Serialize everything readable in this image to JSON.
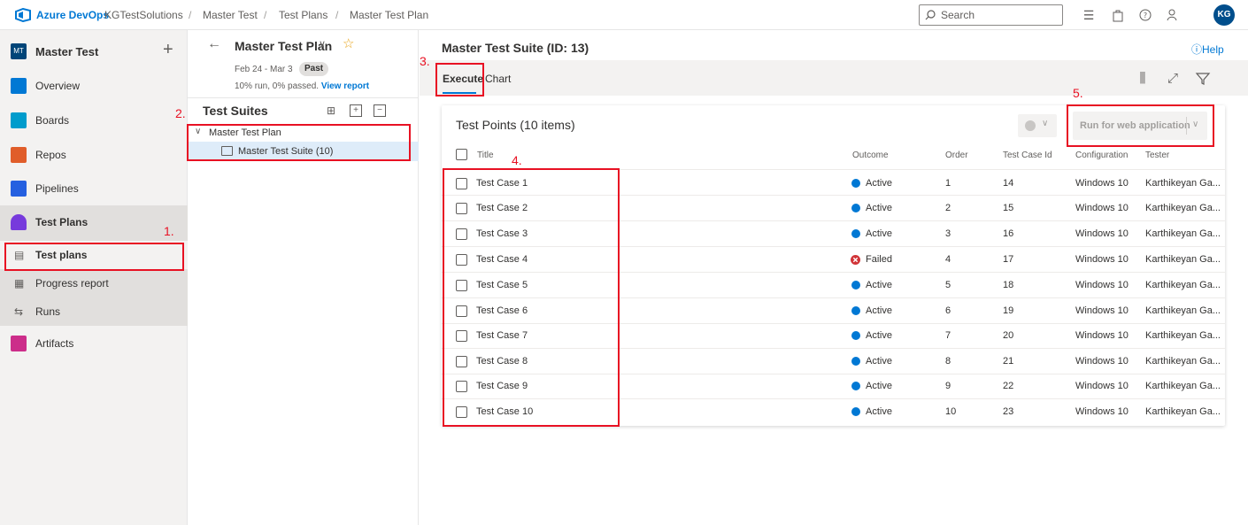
{
  "topbar": {
    "brand": "Azure DevOps",
    "org": "KGTestSolutions",
    "breadcrumbs": [
      "Master Test",
      "Test Plans",
      "Master Test Plan"
    ],
    "separator": "/",
    "search_placeholder": "Search",
    "avatar_initials": "KG"
  },
  "project": {
    "badge": "MT",
    "name": "Master Test",
    "add": "+"
  },
  "nav": {
    "items": [
      {
        "label": "Overview",
        "color": "#0078d4"
      },
      {
        "label": "Boards",
        "color": "#009ccc"
      },
      {
        "label": "Repos",
        "color": "#e05d2a"
      },
      {
        "label": "Pipelines",
        "color": "#2560e0"
      },
      {
        "label": "Test Plans",
        "color": "#773adc"
      },
      {
        "label": "Artifacts",
        "color": "#cc2d8a"
      }
    ],
    "sub_items": [
      {
        "label": "Test plans",
        "icon": "test-plans-icon"
      },
      {
        "label": "Progress report",
        "icon": "progress-report-icon"
      },
      {
        "label": "Runs",
        "icon": "runs-icon"
      }
    ]
  },
  "plan": {
    "title": "Master Test Plan",
    "dates": "Feb 24 - Mar 3",
    "state": "Past",
    "stats": "10% run, 0% passed.",
    "stats_link": "View report"
  },
  "suites": {
    "title": "Test Suites",
    "root": "Master Test Plan",
    "child": "Master Test Suite (10)"
  },
  "annotations": [
    "1.",
    "2.",
    "3.",
    "4.",
    "5."
  ],
  "main": {
    "suite_title": "Master Test Suite (ID: 13)",
    "help": "Help",
    "tabs": [
      "Execute",
      "Chart"
    ],
    "points_title": "Test Points (10 items)",
    "run_button": "Run for web application",
    "columns": [
      "Title",
      "Outcome",
      "Order",
      "Test Case Id",
      "Configuration",
      "Tester"
    ],
    "rows": [
      {
        "title": "Test Case 1",
        "outcome": "Active",
        "order": "1",
        "id": "14",
        "config": "Windows 10",
        "tester": "Karthikeyan Ga..."
      },
      {
        "title": "Test Case 2",
        "outcome": "Active",
        "order": "2",
        "id": "15",
        "config": "Windows 10",
        "tester": "Karthikeyan Ga..."
      },
      {
        "title": "Test Case 3",
        "outcome": "Active",
        "order": "3",
        "id": "16",
        "config": "Windows 10",
        "tester": "Karthikeyan Ga..."
      },
      {
        "title": "Test Case 4",
        "outcome": "Failed",
        "order": "4",
        "id": "17",
        "config": "Windows 10",
        "tester": "Karthikeyan Ga..."
      },
      {
        "title": "Test Case 5",
        "outcome": "Active",
        "order": "5",
        "id": "18",
        "config": "Windows 10",
        "tester": "Karthikeyan Ga..."
      },
      {
        "title": "Test Case 6",
        "outcome": "Active",
        "order": "6",
        "id": "19",
        "config": "Windows 10",
        "tester": "Karthikeyan Ga..."
      },
      {
        "title": "Test Case 7",
        "outcome": "Active",
        "order": "7",
        "id": "20",
        "config": "Windows 10",
        "tester": "Karthikeyan Ga..."
      },
      {
        "title": "Test Case 8",
        "outcome": "Active",
        "order": "8",
        "id": "21",
        "config": "Windows 10",
        "tester": "Karthikeyan Ga..."
      },
      {
        "title": "Test Case 9",
        "outcome": "Active",
        "order": "9",
        "id": "22",
        "config": "Windows 10",
        "tester": "Karthikeyan Ga..."
      },
      {
        "title": "Test Case 10",
        "outcome": "Active",
        "order": "10",
        "id": "23",
        "config": "Windows 10",
        "tester": "Karthikeyan Ga..."
      }
    ]
  },
  "colors": {
    "accent": "#0078d4",
    "active": "#0078d4",
    "failed": "#d13438",
    "annotation": "#e81123"
  }
}
